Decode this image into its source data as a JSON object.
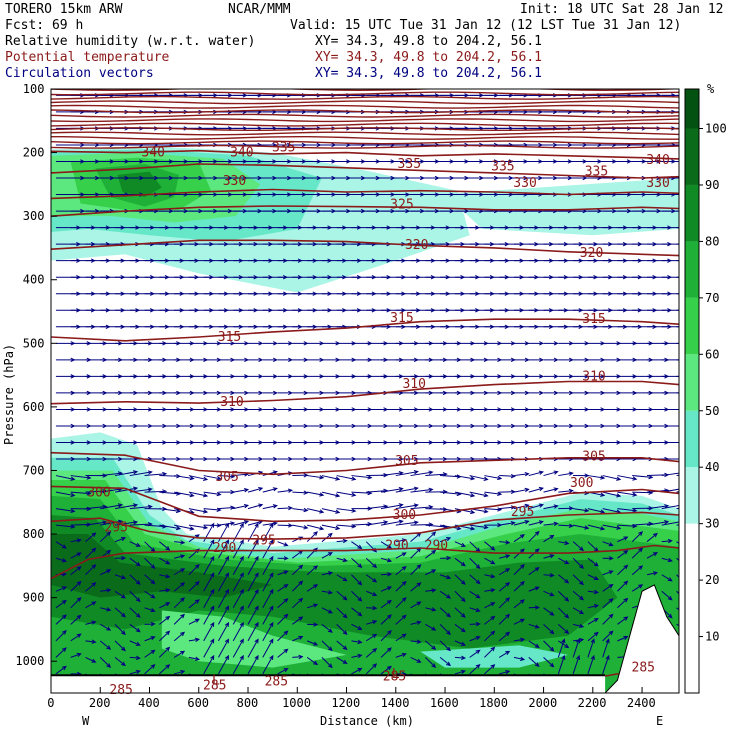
{
  "header": {
    "model": "TORERO  15km ARW",
    "center": "NCAR/MMM",
    "init": "Init: 18 UTC Sat 28 Jan 12",
    "fcst": "Fcst:   69 h",
    "valid": "Valid: 15 UTC Tue 31 Jan 12 (12 LST Tue 31 Jan 12)"
  },
  "fields": [
    {
      "name": "Relative humidity (w.r.t. water)",
      "xy": "XY=  34.3, 49.8 to 204.2, 56.1",
      "color": "#000000"
    },
    {
      "name": "Potential temperature",
      "xy": "XY=  34.3, 49.8 to 204.2, 56.1",
      "color": "#8b1a1a"
    },
    {
      "name": "Circulation vectors",
      "xy": "XY=  34.3, 49.8 to 204.2, 56.1",
      "color": "#000080"
    }
  ],
  "chart_data": {
    "type": "heatmap",
    "title": "",
    "xlabel": "Distance (km)",
    "ylabel": "Pressure (hPa)",
    "xlim": [
      0,
      2550
    ],
    "ylim": [
      1050,
      100
    ],
    "x_ticks": [
      0,
      200,
      400,
      600,
      800,
      1000,
      1200,
      1400,
      1600,
      1800,
      2000,
      2200,
      2400
    ],
    "y_ticks": [
      100,
      200,
      300,
      400,
      500,
      600,
      700,
      800,
      900,
      1000
    ],
    "x_end_labels": {
      "left": "W",
      "right": "E"
    },
    "colorbar": {
      "unit": "%",
      "ticks": [
        10,
        20,
        30,
        40,
        50,
        60,
        70,
        80,
        90,
        100
      ],
      "levels": [
        30,
        40,
        50,
        60,
        70,
        80,
        90,
        100
      ],
      "colors": [
        "#e0fff8",
        "#aaf5e6",
        "#66e8c8",
        "#5ce87f",
        "#36d04a",
        "#1fb038",
        "#108a24",
        "#0a6b1a",
        "#045212"
      ]
    },
    "contour_label_color": "#8b1a1a",
    "vector_color": "#000080",
    "theta_contours": [
      {
        "level": 340,
        "labels": [
          [
            420,
            200
          ],
          [
            780,
            200
          ],
          [
            2470,
            212
          ]
        ],
        "pts": [
          [
            0,
            198
          ],
          [
            300,
            200
          ],
          [
            600,
            197
          ],
          [
            900,
            202
          ],
          [
            1200,
            200
          ],
          [
            1500,
            205
          ],
          [
            1800,
            202
          ],
          [
            2100,
            205
          ],
          [
            2400,
            208
          ],
          [
            2550,
            210
          ]
        ]
      },
      {
        "level": 335,
        "labels": [
          [
            950,
            192
          ],
          [
            1460,
            218
          ],
          [
            1840,
            222
          ],
          [
            2220,
            230
          ]
        ],
        "pts": [
          [
            0,
            232
          ],
          [
            300,
            226
          ],
          [
            600,
            218
          ],
          [
            900,
            220
          ],
          [
            1200,
            224
          ],
          [
            1500,
            228
          ],
          [
            1800,
            232
          ],
          [
            2100,
            236
          ],
          [
            2400,
            240
          ],
          [
            2550,
            238
          ]
        ]
      },
      {
        "level": 330,
        "labels": [
          [
            750,
            245
          ],
          [
            1930,
            248
          ],
          [
            2470,
            248
          ]
        ],
        "pts": [
          [
            0,
            272
          ],
          [
            300,
            268
          ],
          [
            600,
            262
          ],
          [
            900,
            258
          ],
          [
            1200,
            262
          ],
          [
            1500,
            260
          ],
          [
            1800,
            262
          ],
          [
            2100,
            266
          ],
          [
            2400,
            262
          ],
          [
            2550,
            264
          ]
        ]
      },
      {
        "level": 325,
        "labels": [
          [
            1430,
            282
          ]
        ],
        "pts": [
          [
            0,
            300
          ],
          [
            300,
            292
          ],
          [
            600,
            286
          ],
          [
            900,
            284
          ],
          [
            1200,
            285
          ],
          [
            1500,
            286
          ],
          [
            1800,
            290
          ],
          [
            2100,
            290
          ],
          [
            2400,
            286
          ],
          [
            2550,
            288
          ]
        ]
      },
      {
        "level": 320,
        "labels": [
          [
            1490,
            345
          ],
          [
            2200,
            358
          ]
        ],
        "pts": [
          [
            0,
            352
          ],
          [
            300,
            345
          ],
          [
            600,
            338
          ],
          [
            900,
            338
          ],
          [
            1200,
            340
          ],
          [
            1500,
            346
          ],
          [
            1800,
            350
          ],
          [
            2100,
            356
          ],
          [
            2400,
            360
          ],
          [
            2550,
            362
          ]
        ]
      },
      {
        "level": 315,
        "labels": [
          [
            730,
            490
          ],
          [
            1430,
            460
          ],
          [
            2210,
            462
          ]
        ],
        "pts": [
          [
            0,
            490
          ],
          [
            300,
            496
          ],
          [
            600,
            490
          ],
          [
            900,
            482
          ],
          [
            1200,
            476
          ],
          [
            1500,
            466
          ],
          [
            1800,
            462
          ],
          [
            2100,
            462
          ],
          [
            2400,
            466
          ],
          [
            2550,
            470
          ]
        ]
      },
      {
        "level": 310,
        "labels": [
          [
            740,
            592
          ],
          [
            1480,
            564
          ],
          [
            2210,
            552
          ]
        ],
        "pts": [
          [
            0,
            595
          ],
          [
            300,
            592
          ],
          [
            600,
            594
          ],
          [
            900,
            590
          ],
          [
            1200,
            584
          ],
          [
            1500,
            572
          ],
          [
            1800,
            565
          ],
          [
            2100,
            560
          ],
          [
            2400,
            560
          ],
          [
            2550,
            565
          ]
        ]
      },
      {
        "level": 305,
        "labels": [
          [
            720,
            710
          ],
          [
            1450,
            685
          ],
          [
            2210,
            678
          ]
        ],
        "pts": [
          [
            0,
            672
          ],
          [
            300,
            676
          ],
          [
            600,
            700
          ],
          [
            900,
            706
          ],
          [
            1200,
            700
          ],
          [
            1500,
            688
          ],
          [
            1800,
            684
          ],
          [
            2100,
            680
          ],
          [
            2400,
            680
          ],
          [
            2550,
            686
          ]
        ]
      },
      {
        "level": 300,
        "labels": [
          [
            200,
            735
          ],
          [
            1440,
            770
          ],
          [
            2160,
            720
          ]
        ],
        "pts": [
          [
            0,
            725
          ],
          [
            300,
            728
          ],
          [
            600,
            772
          ],
          [
            900,
            780
          ],
          [
            1200,
            778
          ],
          [
            1500,
            770
          ],
          [
            1800,
            756
          ],
          [
            2100,
            736
          ],
          [
            2400,
            730
          ],
          [
            2550,
            736
          ]
        ]
      },
      {
        "level": 295,
        "labels": [
          [
            270,
            790
          ],
          [
            870,
            810
          ],
          [
            1920,
            765
          ]
        ],
        "pts": [
          [
            0,
            780
          ],
          [
            200,
            775
          ],
          [
            400,
            796
          ],
          [
            600,
            806
          ],
          [
            900,
            808
          ],
          [
            1200,
            806
          ],
          [
            1500,
            798
          ],
          [
            1800,
            778
          ],
          [
            2100,
            770
          ],
          [
            2400,
            766
          ],
          [
            2550,
            770
          ]
        ]
      },
      {
        "level": 290,
        "labels": [
          [
            710,
            822
          ],
          [
            1410,
            818
          ],
          [
            1570,
            818
          ]
        ],
        "pts": [
          [
            0,
            870
          ],
          [
            150,
            840
          ],
          [
            300,
            830
          ],
          [
            600,
            826
          ],
          [
            900,
            826
          ],
          [
            1200,
            826
          ],
          [
            1500,
            822
          ],
          [
            1800,
            830
          ],
          [
            2100,
            830
          ],
          [
            2300,
            826
          ],
          [
            2450,
            818
          ],
          [
            2550,
            822
          ]
        ]
      },
      {
        "level": 285,
        "labels": [
          [
            290,
            1045
          ],
          [
            670,
            1038
          ],
          [
            920,
            1032
          ],
          [
            1400,
            1024
          ],
          [
            2410,
            1010
          ]
        ],
        "pts": [
          [
            0,
            1038
          ],
          [
            300,
            1040
          ],
          [
            600,
            1038
          ],
          [
            900,
            1034
          ],
          [
            1200,
            1030
          ],
          [
            1500,
            1026
          ],
          [
            1800,
            1030
          ],
          [
            2100,
            1034
          ],
          [
            2300,
            1020
          ],
          [
            2550,
            1018
          ]
        ]
      }
    ],
    "low_labels": [
      [
        670,
        1030
      ],
      [
        1400,
        1020
      ]
    ]
  }
}
